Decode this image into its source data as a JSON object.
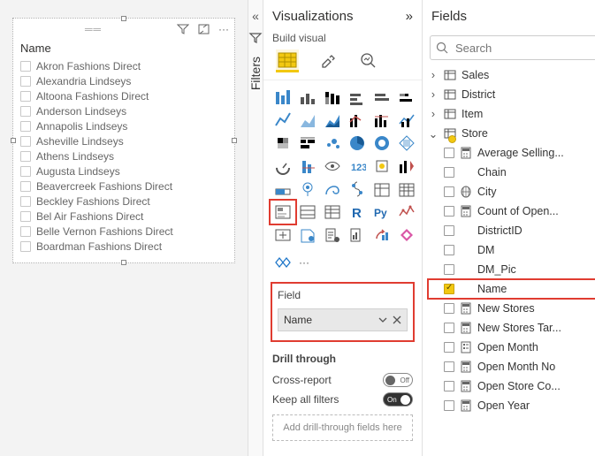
{
  "canvas": {
    "slicer": {
      "title": "Name",
      "items": [
        "Akron Fashions Direct",
        "Alexandria Lindseys",
        "Altoona Fashions Direct",
        "Anderson Lindseys",
        "Annapolis Lindseys",
        "Asheville Lindseys",
        "Athens Lindseys",
        "Augusta Lindseys",
        "Beavercreek Fashions Direct",
        "Beckley Fashions Direct",
        "Bel Air Fashions Direct",
        "Belle Vernon Fashions Direct",
        "Boardman Fashions Direct"
      ]
    }
  },
  "filters_rail": {
    "label": "Filters"
  },
  "viz": {
    "title": "Visualizations",
    "subtitle": "Build visual",
    "field_section_label": "Field",
    "field_chip": "Name",
    "drill": {
      "title": "Drill through",
      "cross_label": "Cross-report",
      "cross_state": "Off",
      "keep_label": "Keep all filters",
      "keep_state": "On",
      "drop_placeholder": "Add drill-through fields here"
    }
  },
  "fields": {
    "title": "Fields",
    "search_placeholder": "Search",
    "tables": [
      {
        "name": "Sales",
        "expanded": false
      },
      {
        "name": "District",
        "expanded": false
      },
      {
        "name": "Item",
        "expanded": false
      },
      {
        "name": "Store",
        "expanded": true,
        "fields": [
          {
            "label": "Average Selling...",
            "checked": false,
            "icon": "calc"
          },
          {
            "label": "Chain",
            "checked": false,
            "icon": "none"
          },
          {
            "label": "City",
            "checked": false,
            "icon": "geo"
          },
          {
            "label": "Count of Open...",
            "checked": false,
            "icon": "calc"
          },
          {
            "label": "DistrictID",
            "checked": false,
            "icon": "none"
          },
          {
            "label": "DM",
            "checked": false,
            "icon": "none"
          },
          {
            "label": "DM_Pic",
            "checked": false,
            "icon": "none"
          },
          {
            "label": "Name",
            "checked": true,
            "icon": "none",
            "highlight": true
          },
          {
            "label": "New Stores",
            "checked": false,
            "icon": "calc"
          },
          {
            "label": "New Stores Tar...",
            "checked": false,
            "icon": "calc"
          },
          {
            "label": "Open Month",
            "checked": false,
            "icon": "hier"
          },
          {
            "label": "Open Month No",
            "checked": false,
            "icon": "calc"
          },
          {
            "label": "Open Store Co...",
            "checked": false,
            "icon": "calc"
          },
          {
            "label": "Open Year",
            "checked": false,
            "icon": "calc"
          }
        ]
      }
    ]
  }
}
